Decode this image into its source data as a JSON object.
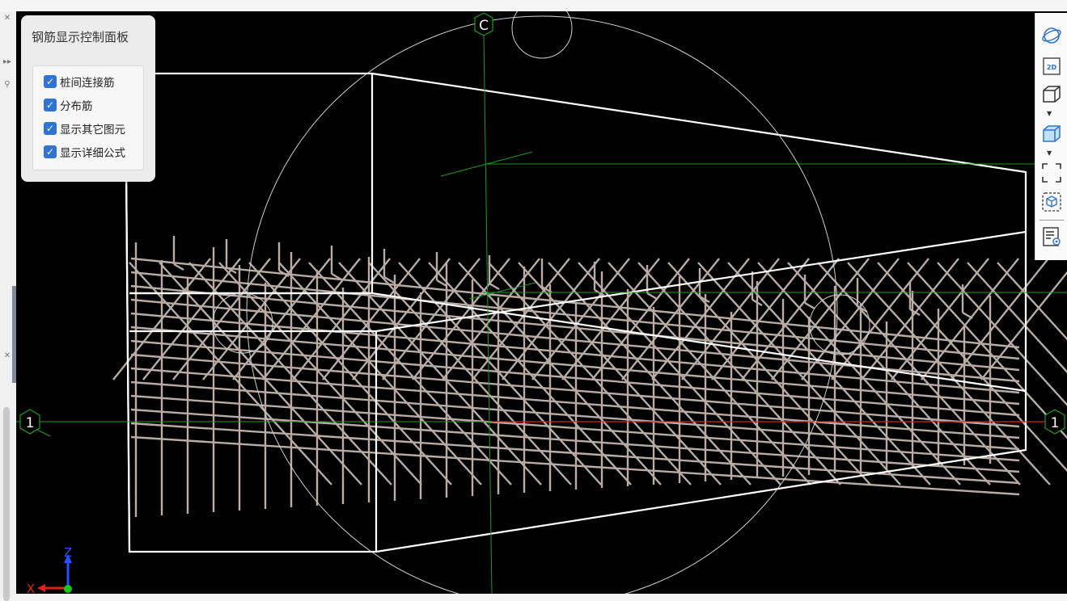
{
  "panel": {
    "title": "钢筋显示控制面板",
    "options": [
      {
        "label": "桩间连接筋",
        "checked": true
      },
      {
        "label": "分布筋",
        "checked": true
      },
      {
        "label": "显示其它图元",
        "checked": true
      },
      {
        "label": "显示详细公式",
        "checked": true
      }
    ]
  },
  "axes": {
    "grid_label_c": "C",
    "grid_label_1_left": "1",
    "grid_label_1_right": "1",
    "triad_z": "Z",
    "triad_x": "X"
  },
  "toolbar": {
    "view_2d_label": "2D",
    "icons": [
      "orbit-icon",
      "2d-view-icon",
      "3d-wireframe-icon",
      "3d-solid-icon",
      "fit-view-icon",
      "component-box-icon",
      "display-settings-icon"
    ]
  },
  "colors": {
    "background": "#000000",
    "rebar": "#b9aca6",
    "outline": "#ffffff",
    "grid_green": "#1f9b1f",
    "axis_red": "#e02020",
    "accent_blue": "#2f74d0"
  }
}
